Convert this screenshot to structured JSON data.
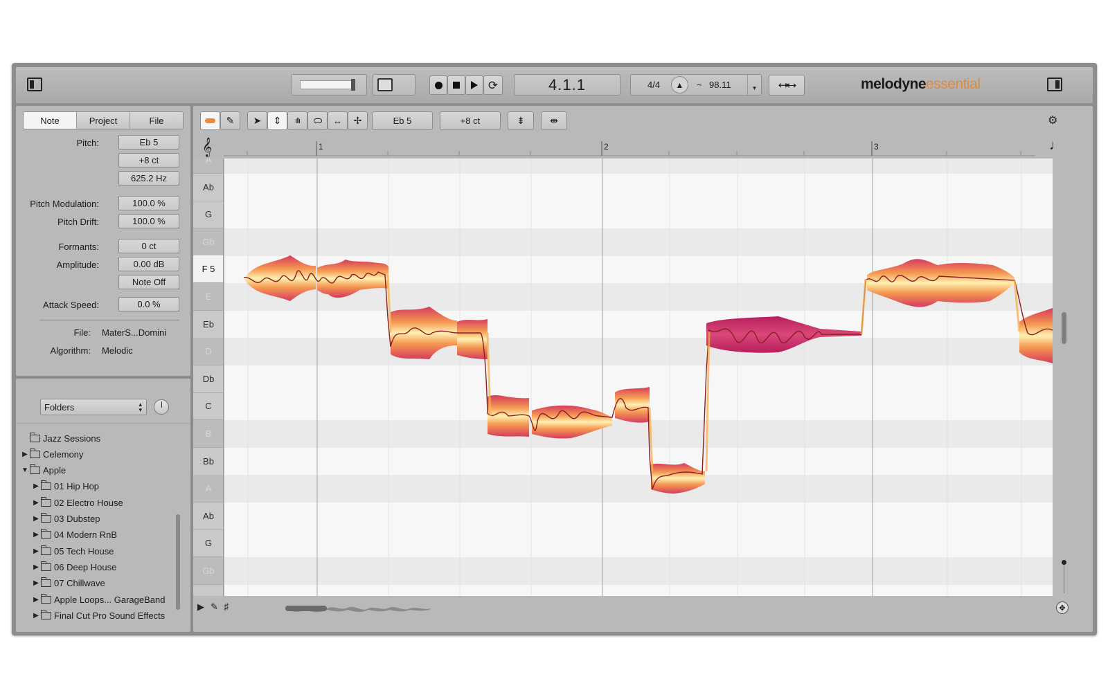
{
  "app": {
    "brand": "melodyne",
    "edition": "essential",
    "accent_color": "#e08a3c"
  },
  "transport": {
    "position": "4.1.1",
    "time_signature": "4/4",
    "tempo_prefix": "~",
    "tempo": "98.11"
  },
  "inspector": {
    "tabs": [
      "Note",
      "Project",
      "File"
    ],
    "active_tab": "Note",
    "pitch_label": "Pitch:",
    "pitch_note": "Eb 5",
    "pitch_cents": "+8 ct",
    "pitch_hz": "625.2 Hz",
    "pitch_modulation_label": "Pitch Modulation:",
    "pitch_modulation": "100.0 %",
    "pitch_drift_label": "Pitch Drift:",
    "pitch_drift": "100.0 %",
    "formants_label": "Formants:",
    "formants": "0 ct",
    "amplitude_label": "Amplitude:",
    "amplitude": "0.00 dB",
    "note_off_button": "Note Off",
    "attack_speed_label": "Attack Speed:",
    "attack_speed": "0.0 %",
    "file_label": "File:",
    "file": "MaterS...Domini",
    "algorithm_label": "Algorithm:",
    "algorithm": "Melodic"
  },
  "browser": {
    "source_select": "Folders",
    "items": [
      {
        "label": "Jazz Sessions",
        "depth": 0,
        "expander": "none"
      },
      {
        "label": "Celemony",
        "depth": 0,
        "expander": "collapsed"
      },
      {
        "label": "Apple",
        "depth": 0,
        "expander": "expanded"
      },
      {
        "label": "01 Hip Hop",
        "depth": 1,
        "expander": "collapsed"
      },
      {
        "label": "02 Electro House",
        "depth": 1,
        "expander": "collapsed"
      },
      {
        "label": "03 Dubstep",
        "depth": 1,
        "expander": "collapsed"
      },
      {
        "label": "04 Modern RnB",
        "depth": 1,
        "expander": "collapsed"
      },
      {
        "label": "05 Tech House",
        "depth": 1,
        "expander": "collapsed"
      },
      {
        "label": "06 Deep House",
        "depth": 1,
        "expander": "collapsed"
      },
      {
        "label": "07 Chillwave",
        "depth": 1,
        "expander": "collapsed"
      },
      {
        "label": "Apple Loops... GarageBand",
        "depth": 1,
        "expander": "collapsed"
      },
      {
        "label": "Final Cut Pro Sound Effects",
        "depth": 1,
        "expander": "collapsed"
      }
    ]
  },
  "editor": {
    "selected_pitch": "Eb 5",
    "selected_cents": "+8 ct",
    "ruler": [
      "1",
      "2",
      "3"
    ],
    "keys": [
      {
        "label": "A",
        "style": "dim"
      },
      {
        "label": "Ab",
        "style": "normal"
      },
      {
        "label": "G",
        "style": "normal"
      },
      {
        "label": "Gb",
        "style": "dim"
      },
      {
        "label": "F 5",
        "style": "highlight"
      },
      {
        "label": "E",
        "style": "dim"
      },
      {
        "label": "Eb",
        "style": "normal"
      },
      {
        "label": "D",
        "style": "dim"
      },
      {
        "label": "Db",
        "style": "normal"
      },
      {
        "label": "C",
        "style": "normal"
      },
      {
        "label": "B",
        "style": "dim"
      },
      {
        "label": "Bb",
        "style": "normal"
      },
      {
        "label": "A",
        "style": "dim"
      },
      {
        "label": "Ab",
        "style": "normal"
      },
      {
        "label": "G",
        "style": "normal"
      },
      {
        "label": "Gb",
        "style": "dim"
      }
    ],
    "blob_colors": [
      "#fff3b0",
      "#f6b25a",
      "#e2533f",
      "#c2185b"
    ]
  }
}
